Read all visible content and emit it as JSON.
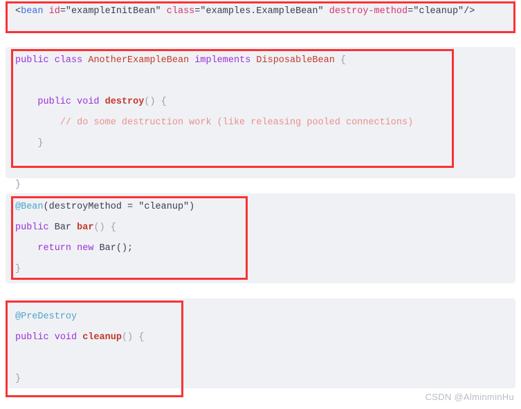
{
  "document": {
    "title": "Spring Bean Destruction Callbacks Code Snippets",
    "background_color": "#ffffff",
    "code_panel_color": "#f0f1f5",
    "highlight_box_color": "#fa3232"
  },
  "watermark": {
    "text": "CSDN @AlminminHu"
  },
  "palette": {
    "xml_tag": "#3a6fd8",
    "xml_attribute": "#d6336c",
    "java_keyword": "#9b30d9",
    "java_type": "#c0392b",
    "java_method": "#c0392b",
    "java_annotation": "#4da3c7",
    "java_comment": "#e8918c",
    "plain_text": "#3b3b4f",
    "brace": "#9aa0ab"
  },
  "blocks": [
    {
      "id": "xml-bean-destroy-method",
      "language": "xml",
      "lines": [
        {
          "id": "xml-line-1",
          "tokens": [
            {
              "text": "<",
              "type": "punct"
            },
            {
              "text": "bean",
              "type": "tag"
            },
            {
              "text": " ",
              "type": "plain"
            },
            {
              "text": "id",
              "type": "attr"
            },
            {
              "text": "=\"exampleInitBean\" ",
              "type": "str"
            },
            {
              "text": "class",
              "type": "attr"
            },
            {
              "text": "=\"examples.ExampleBean\" ",
              "type": "str"
            },
            {
              "text": "destroy-method",
              "type": "attr"
            },
            {
              "text": "=\"cleanup\"/>",
              "type": "str"
            }
          ]
        },
        {
          "id": "xml-line-2",
          "tokens": []
        }
      ]
    },
    {
      "id": "java-another-example-bean",
      "language": "java",
      "lines": [
        {
          "id": "java1-line-1",
          "tokens": [
            {
              "text": "public",
              "type": "kw"
            },
            {
              "text": " ",
              "type": "plain"
            },
            {
              "text": "class",
              "type": "kw"
            },
            {
              "text": " ",
              "type": "plain"
            },
            {
              "text": "AnotherExampleBean",
              "type": "type"
            },
            {
              "text": " ",
              "type": "plain"
            },
            {
              "text": "implements",
              "type": "kw"
            },
            {
              "text": " ",
              "type": "plain"
            },
            {
              "text": "DisposableBean",
              "type": "type"
            },
            {
              "text": " {",
              "type": "brace"
            }
          ]
        },
        {
          "id": "java1-line-2",
          "tokens": []
        },
        {
          "id": "java1-line-3",
          "tokens": [
            {
              "text": "    ",
              "type": "plain"
            },
            {
              "text": "public",
              "type": "kw"
            },
            {
              "text": " ",
              "type": "plain"
            },
            {
              "text": "void",
              "type": "kw"
            },
            {
              "text": " ",
              "type": "plain"
            },
            {
              "text": "destroy",
              "type": "fn"
            },
            {
              "text": "() {",
              "type": "brace"
            }
          ]
        },
        {
          "id": "java1-line-4",
          "tokens": [
            {
              "text": "        ",
              "type": "plain"
            },
            {
              "text": "// do some destruction work (like releasing pooled connections)",
              "type": "comment"
            }
          ]
        },
        {
          "id": "java1-line-5",
          "tokens": [
            {
              "text": "    }",
              "type": "brace"
            }
          ]
        },
        {
          "id": "java1-line-6",
          "tokens": []
        },
        {
          "id": "java1-line-7",
          "tokens": [
            {
              "text": "}",
              "type": "brace"
            }
          ]
        }
      ]
    },
    {
      "id": "java-bean-annotation-destroy-method",
      "language": "java",
      "lines": [
        {
          "id": "java2-line-1",
          "tokens": [
            {
              "text": "@Bean",
              "type": "anno"
            },
            {
              "text": "(destroyMethod = \"cleanup\")",
              "type": "plain"
            }
          ]
        },
        {
          "id": "java2-line-2",
          "tokens": [
            {
              "text": "public",
              "type": "kw"
            },
            {
              "text": " ",
              "type": "plain"
            },
            {
              "text": "Bar",
              "type": "plain"
            },
            {
              "text": " ",
              "type": "plain"
            },
            {
              "text": "bar",
              "type": "fn"
            },
            {
              "text": "() {",
              "type": "brace"
            }
          ]
        },
        {
          "id": "java2-line-3",
          "tokens": [
            {
              "text": "    ",
              "type": "plain"
            },
            {
              "text": "return",
              "type": "kw"
            },
            {
              "text": " ",
              "type": "plain"
            },
            {
              "text": "new",
              "type": "kw"
            },
            {
              "text": " ",
              "type": "plain"
            },
            {
              "text": "Bar();",
              "type": "plain"
            }
          ]
        },
        {
          "id": "java2-line-4",
          "tokens": [
            {
              "text": "}",
              "type": "brace"
            }
          ]
        }
      ]
    },
    {
      "id": "java-predestroy-cleanup",
      "language": "java",
      "lines": [
        {
          "id": "java3-line-1",
          "tokens": [
            {
              "text": "@PreDestroy",
              "type": "anno"
            }
          ]
        },
        {
          "id": "java3-line-2",
          "tokens": [
            {
              "text": "public",
              "type": "kw"
            },
            {
              "text": " ",
              "type": "plain"
            },
            {
              "text": "void",
              "type": "kw"
            },
            {
              "text": " ",
              "type": "plain"
            },
            {
              "text": "cleanup",
              "type": "fn"
            },
            {
              "text": "() {",
              "type": "brace"
            }
          ]
        },
        {
          "id": "java3-line-3",
          "tokens": []
        },
        {
          "id": "java3-line-4",
          "tokens": [
            {
              "text": "}",
              "type": "brace"
            }
          ]
        }
      ]
    }
  ],
  "highlight_boxes": [
    {
      "id": "highlight-xml-bean",
      "label": "xml bean destroy-method highlight"
    },
    {
      "id": "highlight-disposable-bean",
      "label": "DisposableBean implementation highlight"
    },
    {
      "id": "highlight-bean-destroy-method",
      "label": "@Bean destroyMethod highlight"
    },
    {
      "id": "highlight-predestroy",
      "label": "@PreDestroy highlight"
    }
  ]
}
